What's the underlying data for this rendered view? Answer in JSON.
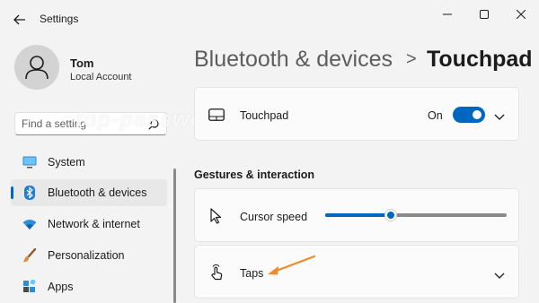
{
  "window": {
    "title": "Settings",
    "controls": [
      "minimize-icon",
      "maximize-icon",
      "close-icon"
    ]
  },
  "account": {
    "name": "Tom",
    "type": "Local Account"
  },
  "search": {
    "placeholder": "Find a setting"
  },
  "nav": {
    "items": [
      {
        "label": "System",
        "icon": "monitor-icon"
      },
      {
        "label": "Bluetooth & devices",
        "icon": "bluetooth-icon",
        "selected": true
      },
      {
        "label": "Network & internet",
        "icon": "wifi-icon"
      },
      {
        "label": "Personalization",
        "icon": "brush-icon"
      },
      {
        "label": "Apps",
        "icon": "apps-icon"
      }
    ]
  },
  "breadcrumb": {
    "parent": "Bluetooth & devices",
    "separator": ">",
    "current": "Touchpad"
  },
  "touchpad_card": {
    "label": "Touchpad",
    "state": "On",
    "enabled": true
  },
  "section": {
    "title": "Gestures & interaction"
  },
  "cursor_speed": {
    "label": "Cursor speed",
    "value_fraction": 0.36
  },
  "taps": {
    "label": "Taps"
  },
  "watermark": "top-password.com",
  "colors": {
    "accent": "#0067c0",
    "background": "#f3f3f3",
    "card": "#fbfbfb",
    "annotation_arrow": "#f08a2a"
  }
}
